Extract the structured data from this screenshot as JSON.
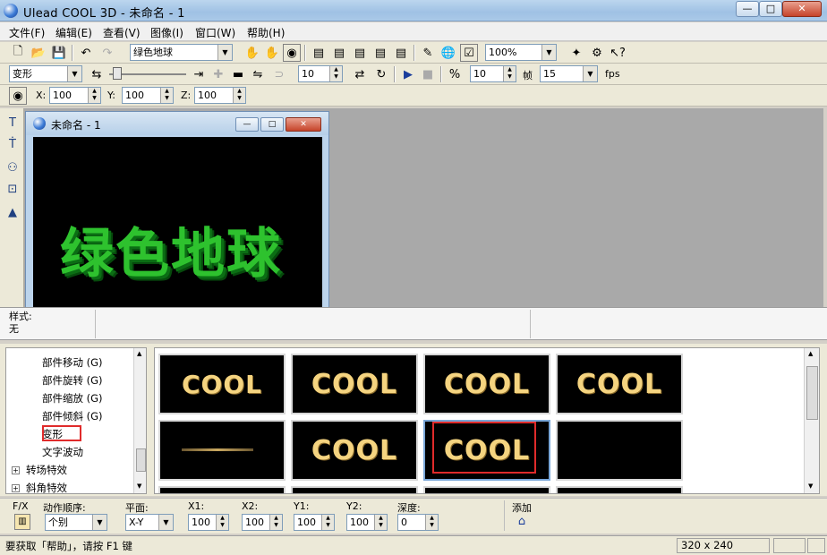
{
  "window": {
    "title": "Ulead COOL 3D - 未命名 - 1",
    "min": "—",
    "max": "□",
    "close": "✕"
  },
  "menu": [
    "文件(F)",
    "编辑(E)",
    "查看(V)",
    "图像(I)",
    "窗口(W)",
    "帮助(H)"
  ],
  "toolbar1": {
    "text_combo": "绿色地球",
    "zoom_combo": "100%"
  },
  "toolbar2": {
    "mode_combo": "变形",
    "frame_value": "10",
    "speed_value": "10",
    "frame_label": "帧",
    "fps_combo": "15",
    "fps_label": "fps"
  },
  "toolbar3": {
    "x_label": "X:",
    "x_value": "100",
    "y_label": "Y:",
    "y_value": "100",
    "z_label": "Z:",
    "z_value": "100"
  },
  "document": {
    "title": "未命名 - 1",
    "canvas_text": "绿色地球"
  },
  "style_panel": {
    "label": "样式:",
    "value": "无"
  },
  "tree": {
    "items": [
      "部件移动 (G)",
      "部件旋转 (G)",
      "部件缩放 (G)",
      "部件倾斜 (G)",
      "变形",
      "文字波动"
    ],
    "roots": [
      "转场特效",
      "斜角特效"
    ],
    "expander": "+"
  },
  "gallery": {
    "labels": [
      "COOL",
      "COOL",
      "COOL",
      "COOL",
      "",
      "COOL",
      "COOL",
      ""
    ]
  },
  "controls": {
    "fx_label": "F/X",
    "order_label": "动作顺序:",
    "order_value": "个别",
    "plane_label": "平面:",
    "plane_value": "X-Y",
    "x1_label": "X1:",
    "x1_value": "100",
    "x2_label": "X2:",
    "x2_value": "100",
    "y1_label": "Y1:",
    "y1_value": "100",
    "y2_label": "Y2:",
    "y2_value": "100",
    "depth_label": "深度:",
    "depth_value": "0",
    "add_label": "添加"
  },
  "status": {
    "help_text": "要获取「帮助」，请按 F1 键",
    "size": "320 x 240"
  }
}
